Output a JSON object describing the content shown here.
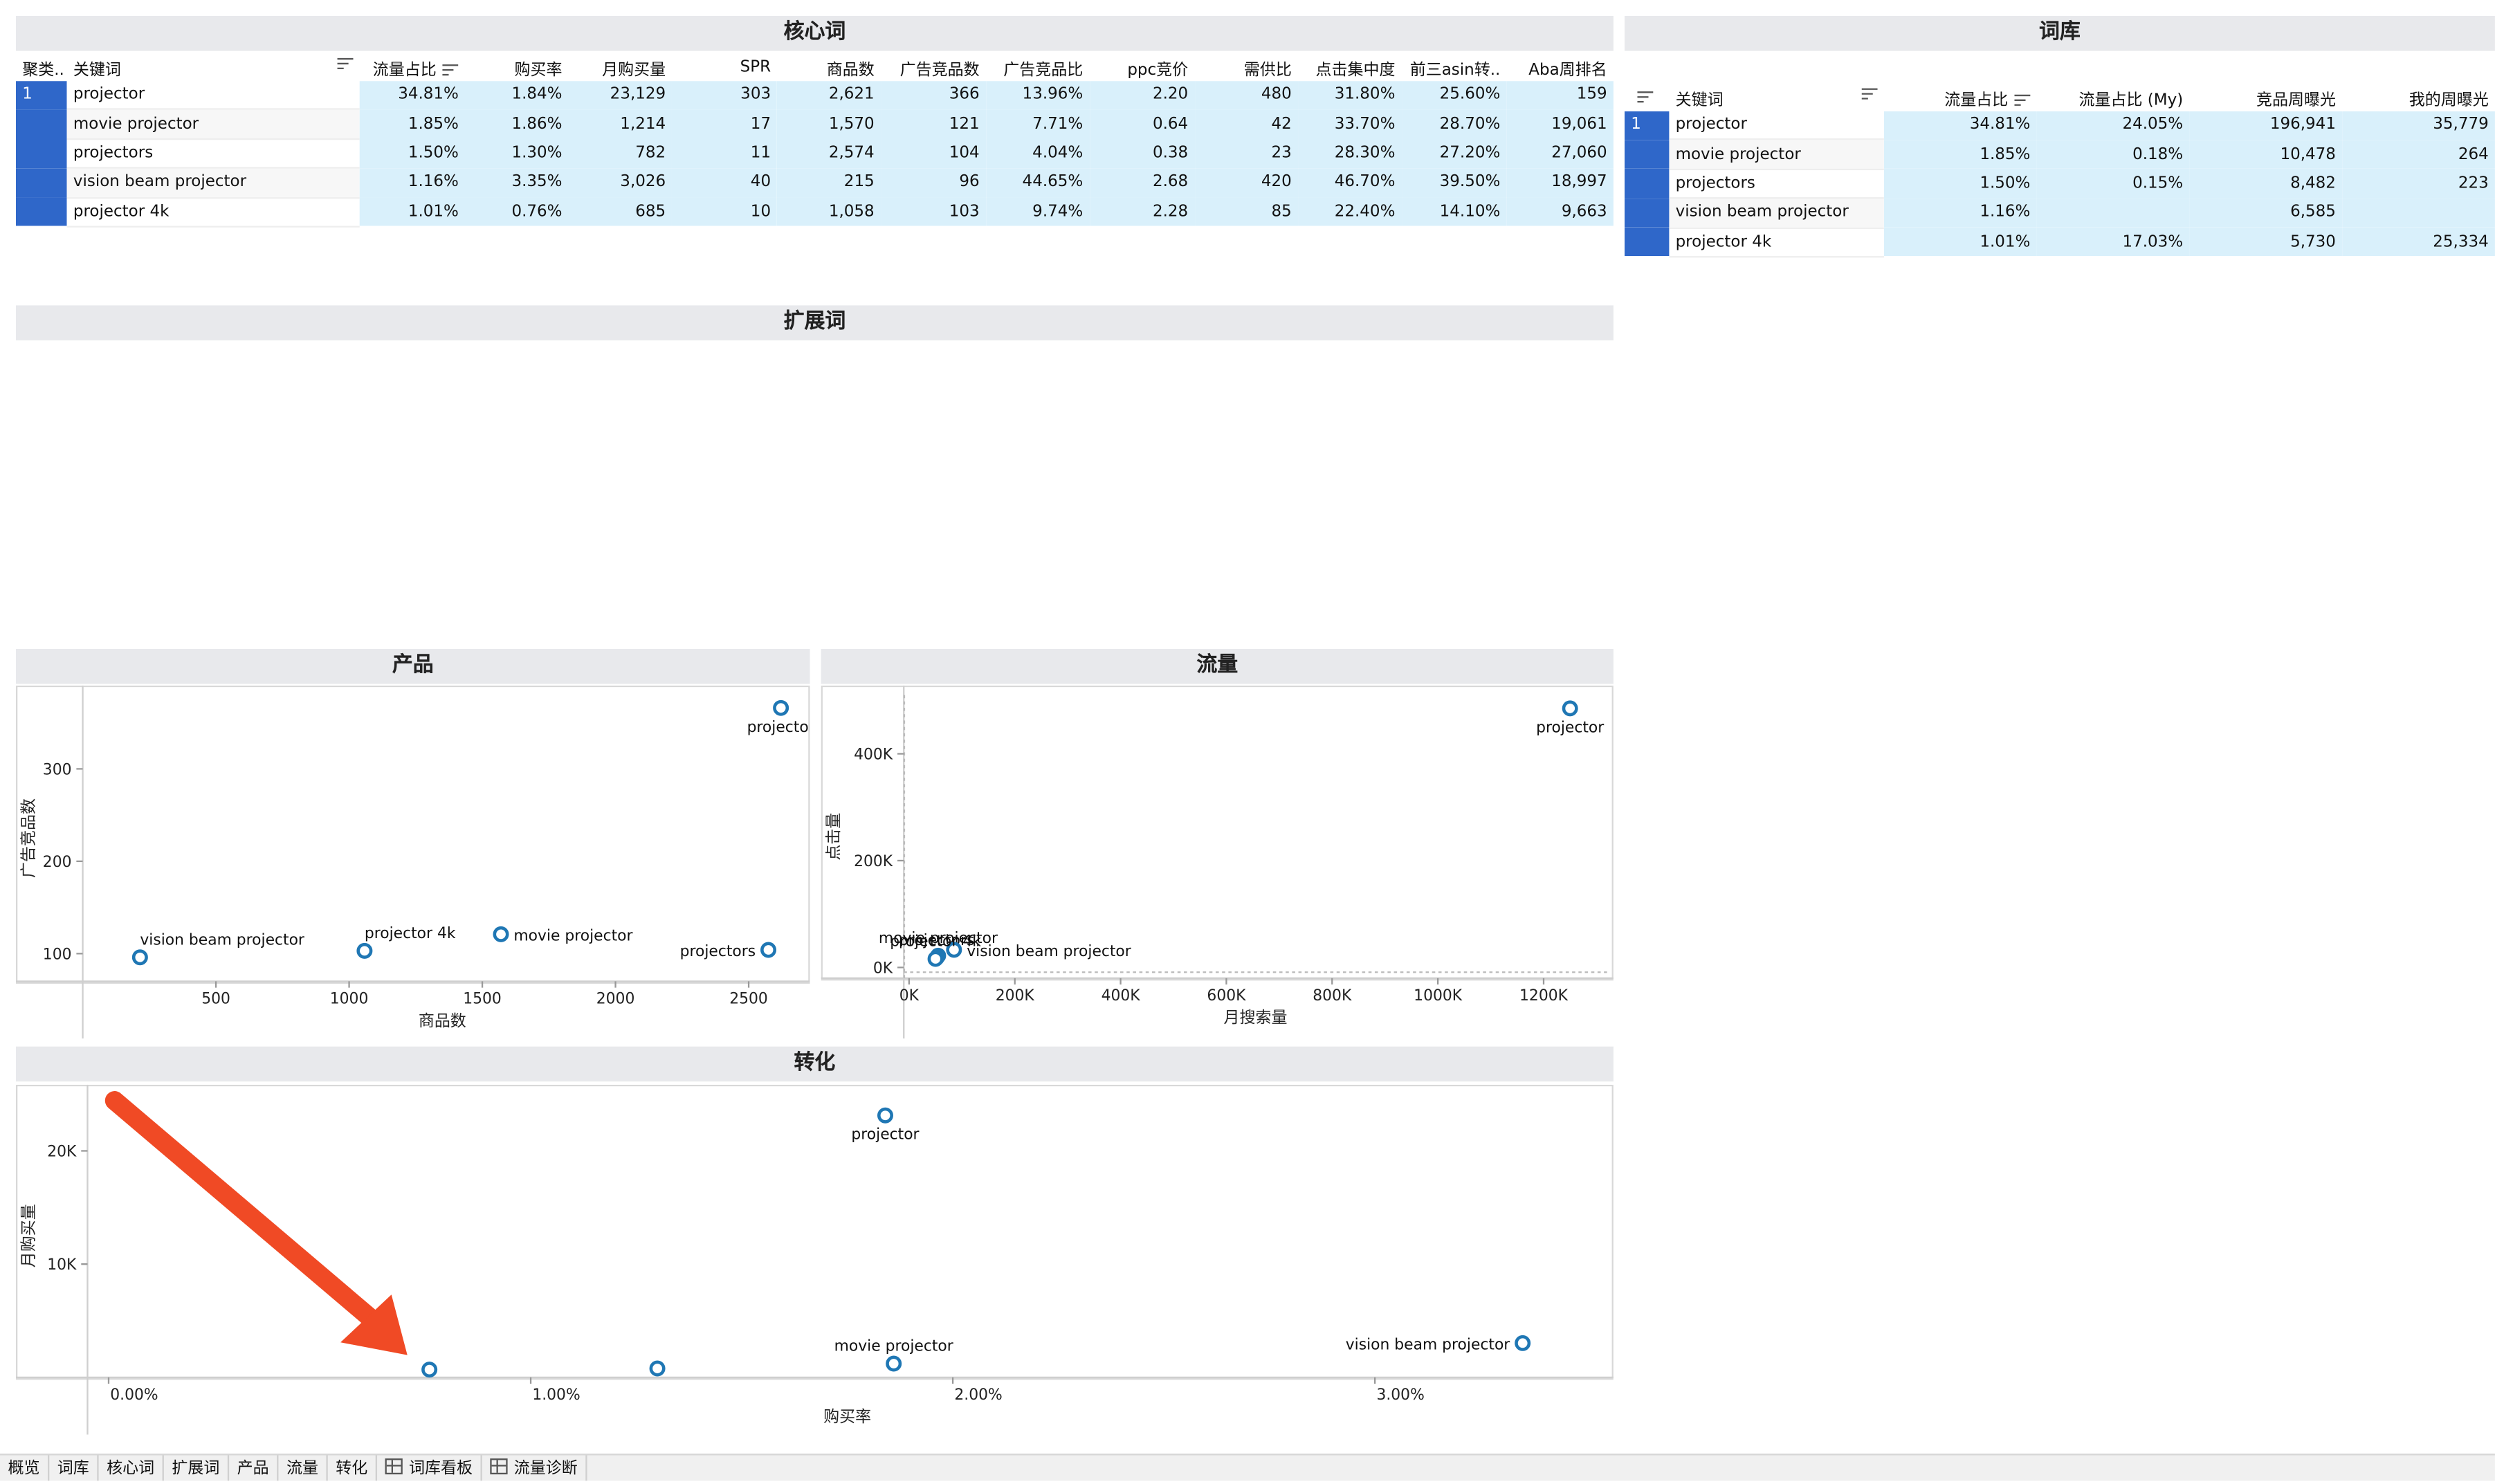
{
  "panels": {
    "core": "核心词",
    "library": "词库",
    "expand": "扩展词",
    "product": "产品",
    "traffic": "流量",
    "conversion": "转化"
  },
  "core_table": {
    "headers": [
      "聚类..",
      "关键词",
      "流量占比",
      "购买率",
      "月购买量",
      "SPR",
      "商品数",
      "广告竞品数",
      "广告竞品比",
      "ppc竞价",
      "需供比",
      "点击集中度",
      "前三asin转..",
      "Aba周排名"
    ],
    "rows": [
      {
        "cluster": "1",
        "kw": "projector",
        "c": [
          "34.81%",
          "1.84%",
          "23,129",
          "303",
          "2,621",
          "366",
          "13.96%",
          "2.20",
          "480",
          "31.80%",
          "25.60%",
          "159"
        ]
      },
      {
        "cluster": "",
        "kw": "movie projector",
        "c": [
          "1.85%",
          "1.86%",
          "1,214",
          "17",
          "1,570",
          "121",
          "7.71%",
          "0.64",
          "42",
          "33.70%",
          "28.70%",
          "19,061"
        ]
      },
      {
        "cluster": "",
        "kw": "projectors",
        "c": [
          "1.50%",
          "1.30%",
          "782",
          "11",
          "2,574",
          "104",
          "4.04%",
          "0.38",
          "23",
          "28.30%",
          "27.20%",
          "27,060"
        ]
      },
      {
        "cluster": "",
        "kw": "vision beam projector",
        "c": [
          "1.16%",
          "3.35%",
          "3,026",
          "40",
          "215",
          "96",
          "44.65%",
          "2.68",
          "420",
          "46.70%",
          "39.50%",
          "18,997"
        ]
      },
      {
        "cluster": "",
        "kw": "projector 4k",
        "c": [
          "1.01%",
          "0.76%",
          "685",
          "10",
          "1,058",
          "103",
          "9.74%",
          "2.28",
          "85",
          "22.40%",
          "14.10%",
          "9,663"
        ]
      }
    ]
  },
  "library_table": {
    "headers": [
      "",
      "关键词",
      "流量占比",
      "流量占比 (My)",
      "竞品周曝光",
      "我的周曝光"
    ],
    "rows": [
      {
        "cluster": "1",
        "kw": "projector",
        "c": [
          "34.81%",
          "24.05%",
          "196,941",
          "35,779"
        ]
      },
      {
        "cluster": "",
        "kw": "movie projector",
        "c": [
          "1.85%",
          "0.18%",
          "10,478",
          "264"
        ]
      },
      {
        "cluster": "",
        "kw": "projectors",
        "c": [
          "1.50%",
          "0.15%",
          "8,482",
          "223"
        ]
      },
      {
        "cluster": "",
        "kw": "vision beam projector",
        "c": [
          "1.16%",
          "",
          "6,585",
          ""
        ]
      },
      {
        "cluster": "",
        "kw": "projector 4k",
        "c": [
          "1.01%",
          "17.03%",
          "5,730",
          "25,334"
        ]
      }
    ]
  },
  "chart_data": [
    {
      "type": "scatter",
      "title": "产品",
      "xlabel": "商品数",
      "ylabel": "广告竞品数",
      "xlim": [
        0,
        2700
      ],
      "ylim": [
        70,
        380
      ],
      "xticks": [
        "500",
        "1000",
        "1500",
        "2000",
        "2500"
      ],
      "xtick_values": [
        500,
        1000,
        1500,
        2000,
        2500
      ],
      "yticks": [
        "100",
        "200",
        "300"
      ],
      "ytick_values": [
        100,
        200,
        300
      ],
      "points": [
        {
          "label": "projector",
          "x": 2621,
          "y": 366
        },
        {
          "label": "movie projector",
          "x": 1570,
          "y": 121
        },
        {
          "label": "projectors",
          "x": 2574,
          "y": 104
        },
        {
          "label": "vision beam projector",
          "x": 215,
          "y": 96
        },
        {
          "label": "projector 4k",
          "x": 1058,
          "y": 103
        }
      ]
    },
    {
      "type": "scatter",
      "title": "流量",
      "xlabel": "月搜索量",
      "ylabel": "点击量",
      "xlim": [
        -10000,
        1320000
      ],
      "ylim": [
        -20000,
        510000
      ],
      "xticks": [
        "0K",
        "200K",
        "400K",
        "600K",
        "800K",
        "1000K",
        "1200K"
      ],
      "xtick_values": [
        0,
        200000,
        400000,
        600000,
        800000,
        1000000,
        1200000
      ],
      "yticks": [
        "0K",
        "200K",
        "400K"
      ],
      "ytick_values": [
        0,
        200000,
        400000
      ],
      "points": [
        {
          "label": "projector",
          "x": 1250000,
          "y": 485000
        },
        {
          "label": "movie projector",
          "x": 55000,
          "y": 22000
        },
        {
          "label": "projectors",
          "x": 52000,
          "y": 18000
        },
        {
          "label": "vision beam projector",
          "x": 85000,
          "y": 33000
        },
        {
          "label": "projector 4k",
          "x": 50000,
          "y": 16000
        }
      ]
    },
    {
      "type": "scatter",
      "title": "转化",
      "xlabel": "购买率",
      "ylabel": "月购买量",
      "xlim": [
        -0.0005,
        0.0355
      ],
      "ylim": [
        0,
        25000
      ],
      "xticks": [
        "0.00%",
        "1.00%",
        "2.00%",
        "3.00%"
      ],
      "xtick_values": [
        0,
        0.01,
        0.02,
        0.03
      ],
      "yticks": [
        "10K",
        "20K"
      ],
      "ytick_values": [
        10000,
        20000
      ],
      "points": [
        {
          "label": "projector",
          "x": 0.0184,
          "y": 23129
        },
        {
          "label": "movie projector",
          "x": 0.0186,
          "y": 1214
        },
        {
          "label": "",
          "x": 0.013,
          "y": 782
        },
        {
          "label": "vision beam projector",
          "x": 0.0335,
          "y": 3026
        },
        {
          "label": "",
          "x": 0.0076,
          "y": 685
        }
      ]
    }
  ],
  "tabs": [
    "概览",
    "词库",
    "核心词",
    "扩展词",
    "产品",
    "流量",
    "转化",
    "词库看板",
    "流量诊断"
  ],
  "colors": {
    "cluster": "#2f67c9",
    "num_bg": "#d9f0fb",
    "point": "#1f77b4",
    "arrow": "#f04a25"
  }
}
